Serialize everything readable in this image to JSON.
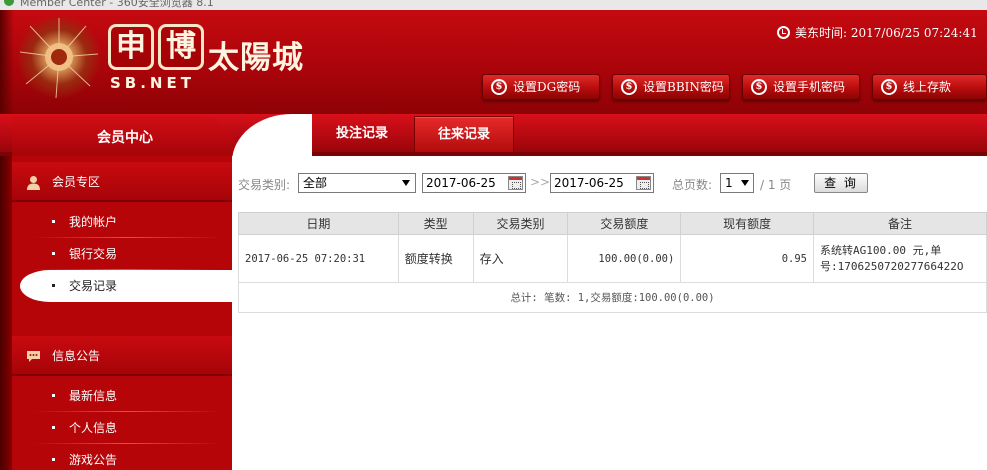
{
  "browser": {
    "title": "Member Center - 360安全浏览器 8.1"
  },
  "header": {
    "logo_box1": "申",
    "logo_box2": "博",
    "logo_cn": "太陽城",
    "logo_en": "SB.NET",
    "clock_label": "美东时间:",
    "clock_value": "2017/06/25 07:24:41",
    "buttons": [
      {
        "label": "设置DG密码",
        "icon": "dollar-icon"
      },
      {
        "label": "设置BBIN密码",
        "icon": "dollar-icon"
      },
      {
        "label": "设置手机密码",
        "icon": "dollar-icon"
      },
      {
        "label": "线上存款",
        "icon": "dollar-icon"
      }
    ]
  },
  "nav": {
    "member_center": "会员中心",
    "tabs": [
      {
        "label": "投注记录",
        "active": false
      },
      {
        "label": "往来记录",
        "active": true
      }
    ]
  },
  "sidebar": {
    "section1": {
      "title": "会员专区",
      "icon": "user-icon"
    },
    "items1": [
      {
        "label": "我的帐户"
      },
      {
        "label": "银行交易"
      },
      {
        "label": "交易记录",
        "active": true
      }
    ],
    "section2": {
      "title": "信息公告",
      "icon": "chat-bubble-icon"
    },
    "items2": [
      {
        "label": "最新信息"
      },
      {
        "label": "个人信息"
      },
      {
        "label": "游戏公告"
      }
    ]
  },
  "filter": {
    "type_label": "交易类别:",
    "type_value": "全部",
    "date_from": "2017-06-25",
    "date_to": "2017-06-25",
    "separator": ">>",
    "pages_label": "总页数:",
    "page_value": "1",
    "page_total": "/ 1 页",
    "query_button": "查 询"
  },
  "table": {
    "headers": [
      "日期",
      "类型",
      "交易类别",
      "交易额度",
      "现有额度",
      "备注"
    ],
    "rows": [
      {
        "date": "2017-06-25 07:20:31",
        "type": "额度转换",
        "category": "存入",
        "amount": "100.00(0.00)",
        "balance": "0.95",
        "note_line1": "系统转AG100.00 元,单",
        "note_line2": "号:170625072027766422O"
      }
    ],
    "total": "总计: 笔数: 1,交易额度:100.00(0.00)"
  },
  "colors": {
    "brand_red": "#b50508",
    "header_red": "#c40a10",
    "table_header_bg": "#e5e5e5"
  }
}
